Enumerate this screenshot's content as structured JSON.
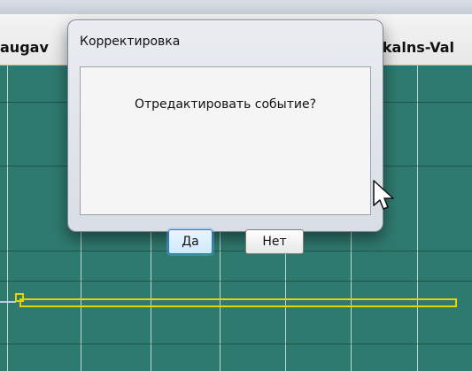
{
  "header": {
    "left_text": "augav",
    "right_text": "rkalns-Val"
  },
  "dialog": {
    "title": "Корректировка",
    "message": "Отредактировать событие?",
    "buttons": {
      "yes_label": "Да",
      "no_label": "Нет"
    }
  },
  "icons": {
    "cursor": "mouse-pointer-icon"
  },
  "colors": {
    "grid_bg": "#2f7a6f",
    "event_yellow": "#e7d300",
    "dialog_border": "#7e8792",
    "primary_button_border": "#2f75c8"
  }
}
